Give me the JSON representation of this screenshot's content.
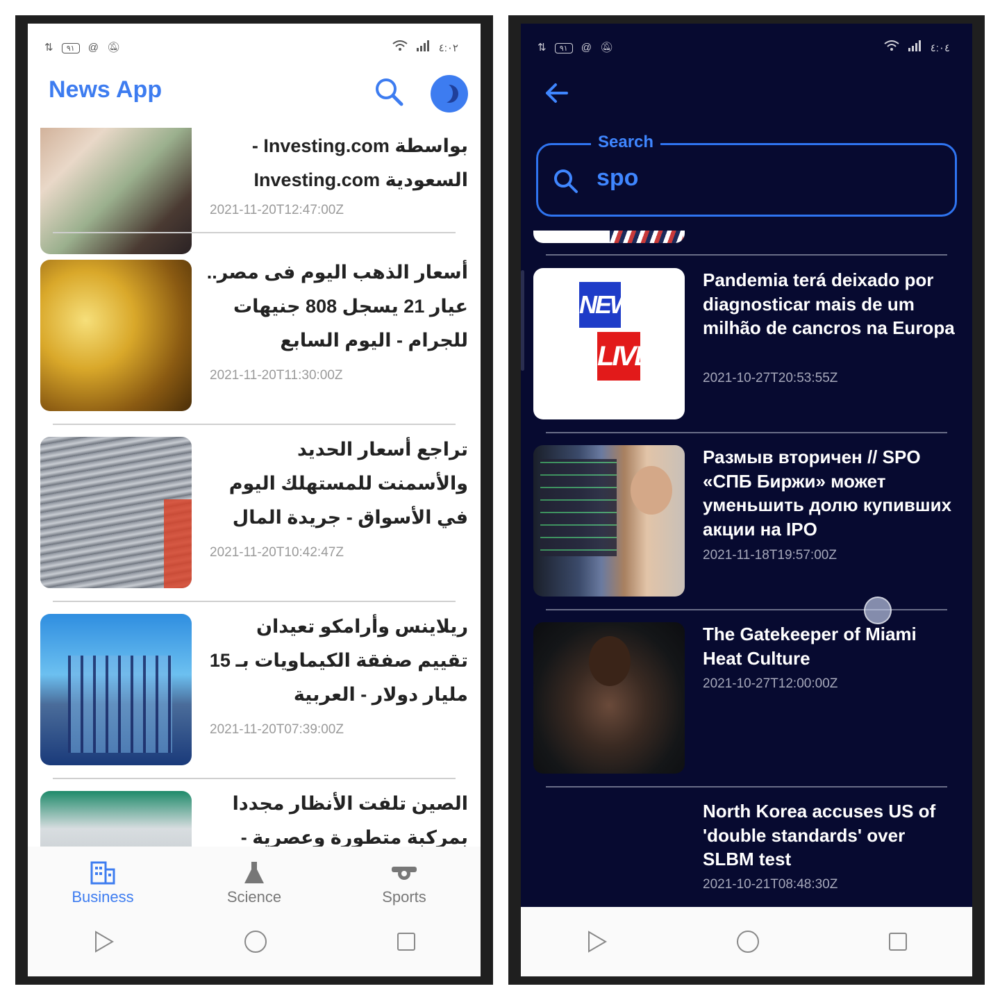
{
  "left": {
    "status": {
      "left_icons": [
        "signal-arrow-icon",
        "battery-pill",
        "at-icon",
        "bell-off-icon"
      ],
      "battery_text": "٩١",
      "time": "٤:٠٢"
    },
    "app_title": "News App",
    "articles": [
      {
        "title": "بواسطة Investing.com - السعودية Investing.com",
        "date": "2021-11-20T12:47:00Z"
      },
      {
        "title": "أسعار الذهب اليوم فى مصر.. عيار 21 يسجل 808 جنيهات للجرام - اليوم السابع",
        "date": "2021-11-20T11:30:00Z"
      },
      {
        "title": "تراجع أسعار الحديد والأسمنت للمستهلك اليوم في الأسواق - جريدة المال",
        "date": "2021-11-20T10:42:47Z"
      },
      {
        "title": "ريلاينس وأرامكو تعيدان تقييم صفقة الكيماويات بـ 15 مليار دولار - العربية",
        "date": "2021-11-20T07:39:00Z"
      },
      {
        "title": "الصين تلفت الأنظار مجددا بمركبة متطورة وعصرية - روسيا اليوم",
        "date": ""
      }
    ],
    "nav": [
      {
        "label": "Business",
        "icon": "business-icon",
        "active": true
      },
      {
        "label": "Science",
        "icon": "flask-icon",
        "active": false
      },
      {
        "label": "Sports",
        "icon": "whistle-icon",
        "active": false
      }
    ],
    "accent": "#3d7cf0"
  },
  "right": {
    "status": {
      "battery_text": "٩١",
      "time": "٤:٠٤"
    },
    "search": {
      "legend": "Search",
      "value": "spo"
    },
    "articles": [
      {
        "title": "Pandemia terá deixado por diagnosticar mais de um milhão de cancros na Europa",
        "date": "2021-10-27T20:53:55Z",
        "image": "news-live-logo"
      },
      {
        "title": "Размыв вторичен // SPO «СПБ Биржи» может уменьшить долю купивших акции на IPO",
        "date": "2021-11-18T19:57:00Z",
        "image": "trader-photo"
      },
      {
        "title": "The Gatekeeper of Miami Heat Culture",
        "date": "2021-10-27T12:00:00Z",
        "image": "athlete-photo"
      },
      {
        "title": "North Korea accuses US of 'double standards' over SLBM test",
        "date": "2021-10-21T08:48:30Z",
        "image": ""
      }
    ],
    "logo_text": {
      "top": "NEWS",
      "bottom": "LIVE"
    },
    "background": "#070a30",
    "accent": "#3f86ff"
  }
}
